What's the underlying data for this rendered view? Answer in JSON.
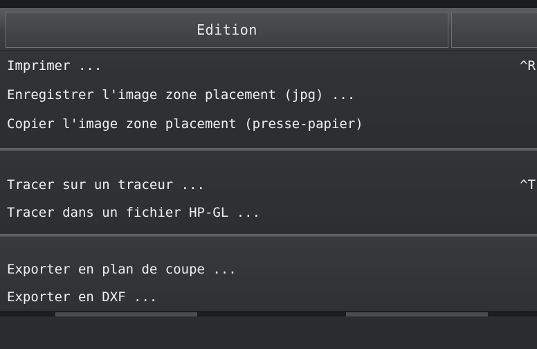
{
  "menubar": {
    "title": "Edition"
  },
  "menu": {
    "groups": [
      {
        "items": [
          {
            "label": "Imprimer ...",
            "shortcut": "^R"
          },
          {
            "label": "Enregistrer l'image zone placement (jpg) ...",
            "shortcut": ""
          },
          {
            "label": "Copier l'image zone placement (presse-papier)",
            "shortcut": ""
          }
        ]
      },
      {
        "items": [
          {
            "label": "Tracer sur un traceur ...",
            "shortcut": "^T"
          },
          {
            "label": "Tracer dans un fichier HP-GL ...",
            "shortcut": ""
          }
        ]
      },
      {
        "items": [
          {
            "label": "Exporter en plan de coupe ...",
            "shortcut": ""
          },
          {
            "label": "Exporter en DXF ...",
            "shortcut": ""
          }
        ]
      }
    ]
  },
  "colors": {
    "menu_background": "#2c2e30",
    "menu_text": "#f0f0f0",
    "separator": "#6a6d70"
  }
}
